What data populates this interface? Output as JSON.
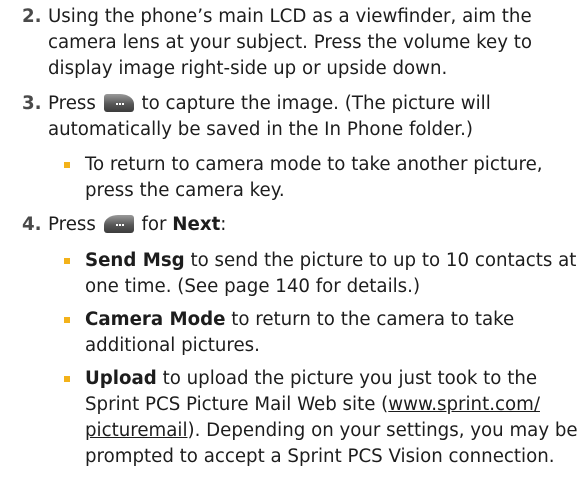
{
  "step2": {
    "number": "2.",
    "line1": "Using the phone’s main LCD as a viewfinder, aim the",
    "line2": "camera lens at your subject. Press the volume key to",
    "line3": "display image right-side up or upside down."
  },
  "step3": {
    "number": "3.",
    "press": "Press",
    "line1_rest": "to capture the image. (The picture will",
    "line2": "automatically be saved in the In Phone folder.)",
    "bullet1_line1": "To return to camera mode to take another picture,",
    "bullet1_line2": "press the camera key."
  },
  "step4": {
    "number": "4.",
    "press": "Press",
    "for": "for",
    "next": "Next",
    "colon": ":",
    "send_bold": "Send Msg",
    "send_line1_rest": " to send the picture to up to 10 contacts at",
    "send_line2": "one time. (See page 140 for details.)",
    "camera_bold": "Camera Mode",
    "camera_line1_rest": " to return to the camera to take",
    "camera_line2": "additional pictures.",
    "upload_bold": "Upload",
    "upload_line1_rest": " to upload the picture you just took to the",
    "upload_line2_pre": "Sprint PCS Picture Mail Web site (",
    "upload_link1": "www.sprint.com/",
    "upload_link2": "picturemail",
    "upload_line3_rest": "). Depending on your settings, you may be",
    "upload_line4": "prompted to accept a Sprint PCS Vision connection."
  },
  "icons": {
    "left_softkey": "left-softkey-icon",
    "right_softkey": "right-softkey-icon",
    "bullet_color": "#f3b21a"
  }
}
